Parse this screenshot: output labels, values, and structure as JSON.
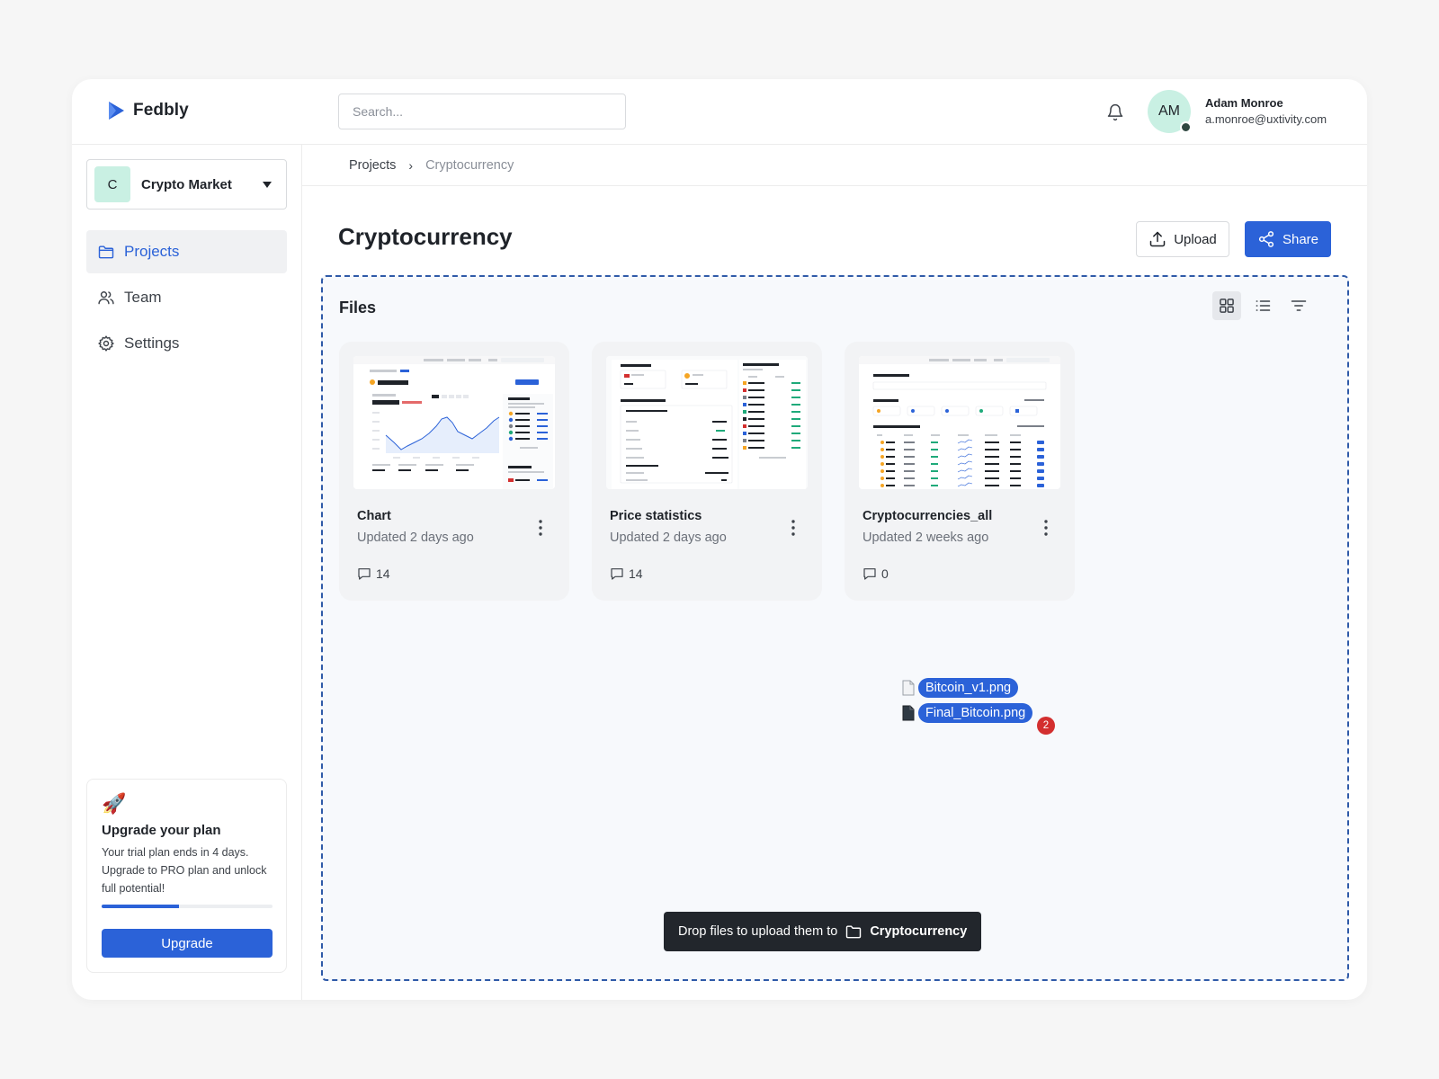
{
  "app": {
    "name": "Fedbly"
  },
  "search": {
    "placeholder": "Search..."
  },
  "user": {
    "initials": "AM",
    "name": "Adam Monroe",
    "email": "a.monroe@uxtivity.com"
  },
  "workspace": {
    "initial": "C",
    "name": "Crypto Market"
  },
  "nav": [
    {
      "label": "Projects",
      "icon": "folder-icon",
      "active": true
    },
    {
      "label": "Team",
      "icon": "users-icon",
      "active": false
    },
    {
      "label": "Settings",
      "icon": "gear-icon",
      "active": false
    }
  ],
  "upgrade": {
    "icon": "🚀",
    "title": "Upgrade your plan",
    "text": "Your trial plan ends in 4 days. Upgrade to PRO plan and unlock full potential!",
    "progress_fraction": 0.45,
    "button": "Upgrade"
  },
  "breadcrumb": {
    "parent": "Projects",
    "current": "Cryptocurrency"
  },
  "page": {
    "title": "Cryptocurrency"
  },
  "actions": {
    "upload": "Upload",
    "share": "Share"
  },
  "files": {
    "title": "Files",
    "items": [
      {
        "name": "Chart",
        "updated": "Updated 2 days ago",
        "comments": "14"
      },
      {
        "name": "Price statistics",
        "updated": "Updated 2 days ago",
        "comments": "14"
      },
      {
        "name": "Cryptocurrencies_all",
        "updated": "Updated 2 weeks ago",
        "comments": "0"
      }
    ]
  },
  "drag": {
    "files": [
      "Bitcoin_v1.png",
      "Final_Bitcoin.png"
    ],
    "count": "2"
  },
  "drop": {
    "message": "Drop files to upload them to",
    "target": "Cryptocurrency"
  },
  "colors": {
    "accent": "#2b62d8",
    "badge": "#d32f2f",
    "mint": "#c9f0e3",
    "dropzone_border": "#2f5aa8"
  }
}
